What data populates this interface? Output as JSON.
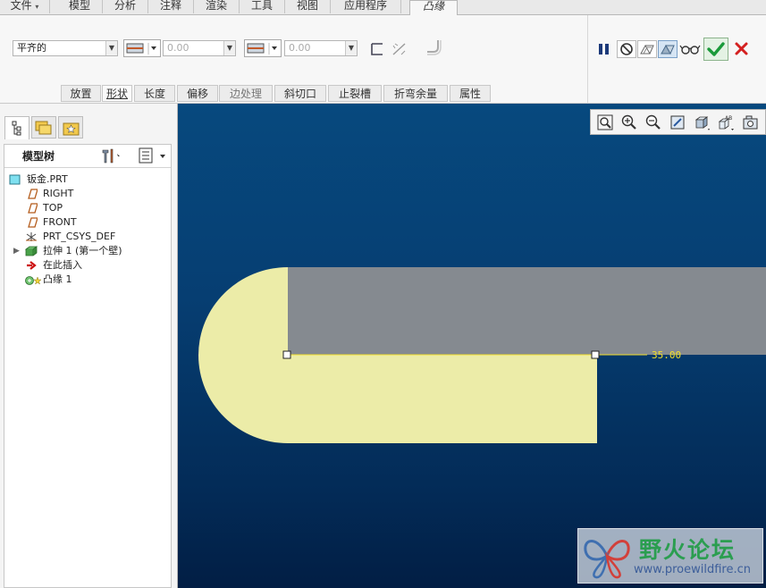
{
  "menubar": {
    "items": [
      {
        "label": "文件",
        "caret": "▾"
      },
      {
        "label": "模型"
      },
      {
        "label": "分析"
      },
      {
        "label": "注释"
      },
      {
        "label": "渲染"
      },
      {
        "label": "工具"
      },
      {
        "label": "视图"
      },
      {
        "label": "应用程序"
      },
      {
        "label": "凸缘"
      }
    ]
  },
  "ribbon": {
    "profile_select": "平齐的",
    "length1_value": "0.00",
    "length2_value": "0.00",
    "subtabs": [
      "放置",
      "形状",
      "长度",
      "偏移",
      "边处理",
      "斜切口",
      "止裂槽",
      "折弯余量",
      "属性"
    ]
  },
  "left_panel": {
    "tree_header": "模型树",
    "items": [
      {
        "label": "钣金.PRT",
        "icon": "part-icon"
      },
      {
        "label": "RIGHT",
        "icon": "datum-plane-icon"
      },
      {
        "label": "TOP",
        "icon": "datum-plane-icon"
      },
      {
        "label": "FRONT",
        "icon": "datum-plane-icon"
      },
      {
        "label": "PRT_CSYS_DEF",
        "icon": "csys-icon"
      },
      {
        "label": "拉伸 1 (第一个壁)",
        "icon": "extrude-wall-icon"
      },
      {
        "label": "在此插入",
        "icon": "insert-here-arrow-icon"
      },
      {
        "label": "凸缘 1",
        "icon": "flange-icon"
      }
    ]
  },
  "viewport": {
    "dimension_label": "35.00"
  },
  "watermark": {
    "title": "野火论坛",
    "url": "www.proewildfire.cn"
  },
  "colors": {
    "viewport_top": "#07497e",
    "viewport_bottom": "#021e44",
    "flange_fill": "#ececa8",
    "wall_fill": "#858a90",
    "dimension": "#f5e02a",
    "ok": "#1a9a3a",
    "cancel": "#d42020"
  }
}
